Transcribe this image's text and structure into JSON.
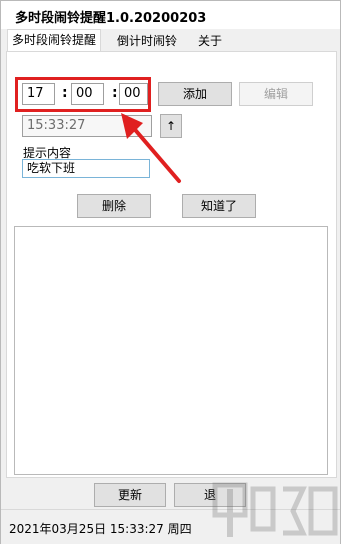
{
  "window": {
    "title": "多时段闹铃提醒1.0.20200203"
  },
  "tabs": [
    {
      "label": "多时段闹铃提醒",
      "active": true
    },
    {
      "label": "倒计时闹铃",
      "active": false
    },
    {
      "label": "关于",
      "active": false
    }
  ],
  "alarm": {
    "hour": "17",
    "minute": "00",
    "second": "00",
    "separator": ":",
    "current_time": "15:33:27",
    "add_label": "添加",
    "edit_label": "编辑",
    "up_label": "↑",
    "note_label": "提示内容",
    "note_value": "吃软下班",
    "delete_label": "删除",
    "ack_label": "知道了"
  },
  "footer": {
    "refresh_label": "更新",
    "exit_label": "退",
    "status_text": "2021年03月25日 15:33:27 周四"
  },
  "colors": {
    "highlight": "#e02020",
    "arrow": "#e02020"
  },
  "icons": {
    "annotation": "arrow-icon",
    "watermark": "site-watermark-icon"
  }
}
